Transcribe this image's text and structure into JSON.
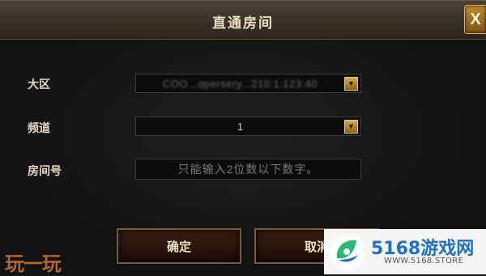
{
  "dialog": {
    "title": "直通房间",
    "close_label": "X"
  },
  "form": {
    "region": {
      "label": "大区",
      "value": "COO...opersery...210:1:123:40"
    },
    "channel": {
      "label": "频道",
      "value": "1"
    },
    "room": {
      "label": "房间号",
      "placeholder": "只能输入2位数以下数字。"
    }
  },
  "buttons": {
    "confirm": "确定",
    "cancel": "取消"
  },
  "branding": {
    "left_logo": "玩一玩",
    "watermark_name": "5168游戏网",
    "watermark_url": "WWW.5168.STORE"
  },
  "colors": {
    "accent_gold": "#c08a33",
    "watermark_blue": "#1f6fc7",
    "watermark_green": "#2bb673"
  },
  "icons": {
    "dropdown": "chevron-down-icon",
    "close": "close-icon"
  }
}
